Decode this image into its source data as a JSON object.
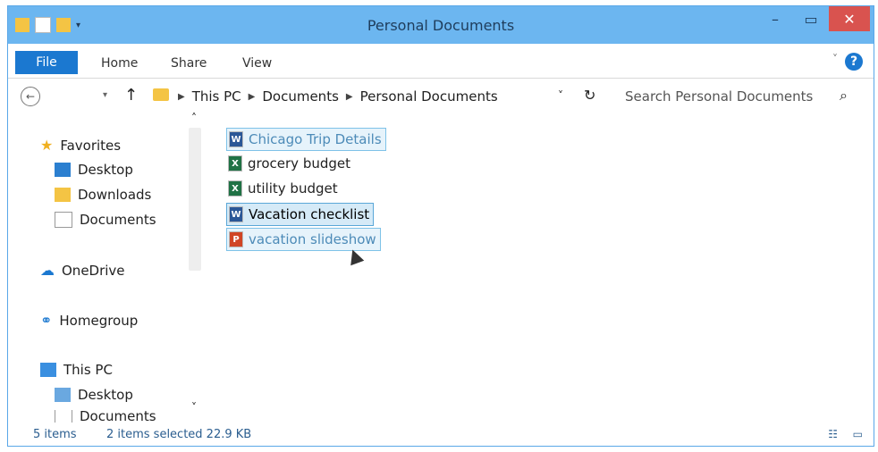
{
  "window": {
    "title": "Personal Documents"
  },
  "ribbon": {
    "tabs": [
      "File",
      "Home",
      "Share",
      "View"
    ]
  },
  "address": {
    "breadcrumb": [
      "This PC",
      "Documents",
      "Personal Documents"
    ],
    "search_placeholder": "Search Personal Documents"
  },
  "nav": {
    "favorites": "Favorites",
    "items": [
      "Desktop",
      "Downloads",
      "Documents"
    ],
    "onedrive": "OneDrive",
    "homegroup": "Homegroup",
    "thispc": "This PC",
    "thispc_items": [
      "Desktop",
      "Documents"
    ]
  },
  "files": [
    {
      "name": "Chicago Trip Details",
      "type": "word",
      "state": "selected"
    },
    {
      "name": "grocery budget",
      "type": "excel",
      "state": "normal"
    },
    {
      "name": "utility budget",
      "type": "excel",
      "state": "normal"
    },
    {
      "name": "Vacation checklist",
      "type": "word",
      "state": "focus"
    },
    {
      "name": "vacation slideshow",
      "type": "ppt",
      "state": "selected"
    }
  ],
  "status": {
    "items": "5 items",
    "selected": "2 items selected  22.9 KB"
  },
  "colors": {
    "titlebar": "#6cb6f0",
    "accent": "#1b78d0",
    "close": "#d9534f"
  },
  "icons": [
    "folder-icon",
    "help-icon",
    "search-icon",
    "refresh-icon",
    "star-icon",
    "cloud-icon",
    "homegroup-icon",
    "pc-icon",
    "word-icon",
    "excel-icon",
    "powerpoint-icon"
  ]
}
